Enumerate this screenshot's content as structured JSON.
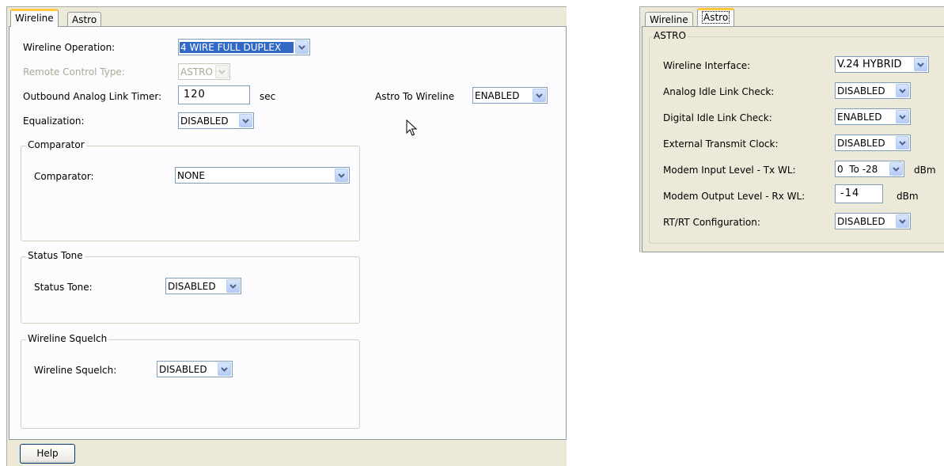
{
  "left": {
    "tabs": [
      {
        "label": "Wireline",
        "active": true
      },
      {
        "label": "Astro",
        "active": false
      }
    ],
    "fields": {
      "wireline_operation": {
        "label": "Wireline Operation:",
        "value": "4 WIRE FULL DUPLEX"
      },
      "remote_control_type": {
        "label": "Remote Control Type:",
        "value": "ASTRO"
      },
      "outbound_timer": {
        "label": "Outbound Analog Link Timer:",
        "value": "120",
        "unit": "sec"
      },
      "astro_to_wireline": {
        "label": "Astro To Wireline",
        "value": "ENABLED"
      },
      "equalization": {
        "label": "Equalization:",
        "value": "DISABLED"
      }
    },
    "groups": {
      "comparator": {
        "title": "Comparator",
        "label": "Comparator:",
        "value": "NONE"
      },
      "status_tone": {
        "title": "Status Tone",
        "label": "Status Tone:",
        "value": "DISABLED"
      },
      "wireline_squelch": {
        "title": "Wireline Squelch",
        "label": "Wireline Squelch:",
        "value": "DISABLED"
      }
    },
    "help_button": "Help"
  },
  "right": {
    "tabs": [
      {
        "label": "Wireline",
        "active": false
      },
      {
        "label": "Astro",
        "active": true
      }
    ],
    "group_title": "ASTRO",
    "fields": {
      "wireline_interface": {
        "label": "Wireline Interface:",
        "value": "V.24 HYBRID"
      },
      "analog_idle": {
        "label": "Analog Idle Link Check:",
        "value": "DISABLED"
      },
      "digital_idle": {
        "label": "Digital Idle Link Check:",
        "value": "ENABLED"
      },
      "ext_tx_clock": {
        "label": "External Transmit Clock:",
        "value": "DISABLED"
      },
      "modem_input": {
        "label": "Modem Input Level - Tx WL:",
        "value": "0  To -28",
        "unit": "dBm"
      },
      "modem_output": {
        "label": "Modem Output Level - Rx WL:",
        "value": "-14",
        "unit": "dBm"
      },
      "rtrt_config": {
        "label": "RT/RT Configuration:",
        "value": "DISABLED"
      }
    }
  },
  "icons": {
    "dropdown": "chevron-down-icon",
    "cursor": "mouse-pointer-icon"
  },
  "colors": {
    "panel_bg": "#ece9d8",
    "selection": "#316ac5",
    "active_tab_accent": "#ffc83c",
    "combo_button": "#c4d6fb"
  }
}
